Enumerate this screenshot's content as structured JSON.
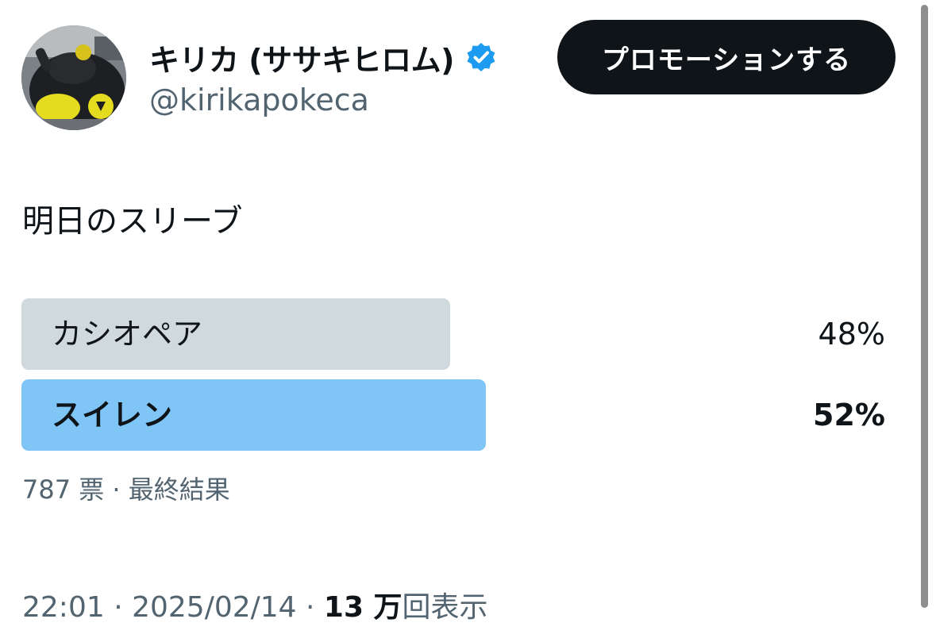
{
  "author": {
    "display_name": "キリカ (ササキヒロム)",
    "handle": "@kirikapokeca",
    "verified": true,
    "avatar_icon": "plush-toy-avatar"
  },
  "promote_button": {
    "label": "プロモーションする"
  },
  "tweet": {
    "text": "明日のスリーブ"
  },
  "poll": {
    "options": [
      {
        "label": "カシオペア",
        "percent_text": "48%",
        "percent": 48,
        "winner": false,
        "bar_color": "#cfd9de"
      },
      {
        "label": "スイレン",
        "percent_text": "52%",
        "percent": 52,
        "winner": true,
        "bar_color": "#7fc5f6"
      }
    ],
    "meta": "787 票 · 最終結果"
  },
  "footer": {
    "time_date": "22:01 · 2025/02/14 · ",
    "views_count": "13 万",
    "views_label": "回表示"
  },
  "colors": {
    "text_primary": "#0f1419",
    "text_secondary": "#536471",
    "verified_blue": "#1d9bf0",
    "button_bg": "#0f1419"
  }
}
